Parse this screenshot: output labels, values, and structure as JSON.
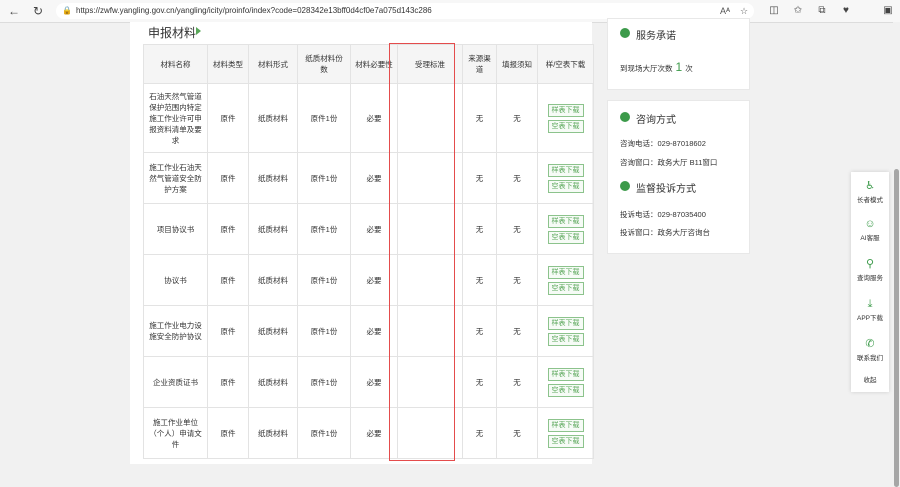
{
  "browser": {
    "url": "https://zwfw.yangling.gov.cn/yangling/icity/proinfo/index?code=028342e13bff0d4cf0e7a075d143c286",
    "reader_label": "Aᴬ"
  },
  "section_title": "申报材料",
  "table": {
    "headers": [
      "材料名称",
      "材料类型",
      "材料形式",
      "纸质材料份数",
      "材料必要性",
      "受理标准",
      "来源渠道",
      "填报须知",
      "样/空表下载"
    ],
    "download_sample": "样表下载",
    "download_blank": "空表下载",
    "rows": [
      {
        "name": "石油天然气管道保护范围内特定施工作业许可申报资料清单及要求",
        "type": "原件",
        "form": "纸质材料",
        "copies": "原件1份",
        "required": "必要",
        "standard": "",
        "source": "无",
        "notice": "无"
      },
      {
        "name": "施工作业石油天然气管道安全防护方案",
        "type": "原件",
        "form": "纸质材料",
        "copies": "原件1份",
        "required": "必要",
        "standard": "",
        "source": "无",
        "notice": "无"
      },
      {
        "name": "项目协议书",
        "type": "原件",
        "form": "纸质材料",
        "copies": "原件1份",
        "required": "必要",
        "standard": "",
        "source": "无",
        "notice": "无"
      },
      {
        "name": "协议书",
        "type": "原件",
        "form": "纸质材料",
        "copies": "原件1份",
        "required": "必要",
        "standard": "",
        "source": "无",
        "notice": "无"
      },
      {
        "name": "施工作业电力设施安全防护协议",
        "type": "原件",
        "form": "纸质材料",
        "copies": "原件1份",
        "required": "必要",
        "standard": "",
        "source": "无",
        "notice": "无"
      },
      {
        "name": "企业资质证书",
        "type": "原件",
        "form": "纸质材料",
        "copies": "原件1份",
        "required": "必要",
        "standard": "",
        "source": "无",
        "notice": "无"
      },
      {
        "name": "施工作业单位（个人）申请文件",
        "type": "原件",
        "form": "纸质材料",
        "copies": "原件1份",
        "required": "必要",
        "standard": "",
        "source": "无",
        "notice": "无"
      }
    ]
  },
  "service": {
    "title": "服务承诺",
    "visits_prefix": "到现场大厅次数",
    "visits_count": "1",
    "visits_suffix": "次"
  },
  "consult": {
    "title": "咨询方式",
    "phone": "咨询电话：029-87018602",
    "window": "咨询窗口：政务大厅 B11窗口"
  },
  "complaint": {
    "title": "监督投诉方式",
    "phone": "投诉电话：029-87035400",
    "window": "投诉窗口：政务大厅咨询台"
  },
  "sidebar": {
    "items": [
      "长者模式",
      "AI客服",
      "查询服务",
      "APP下载",
      "联系我们",
      "收起"
    ]
  },
  "colors": {
    "accent": "#3c9a4a",
    "highlight": "#e44c4c"
  }
}
